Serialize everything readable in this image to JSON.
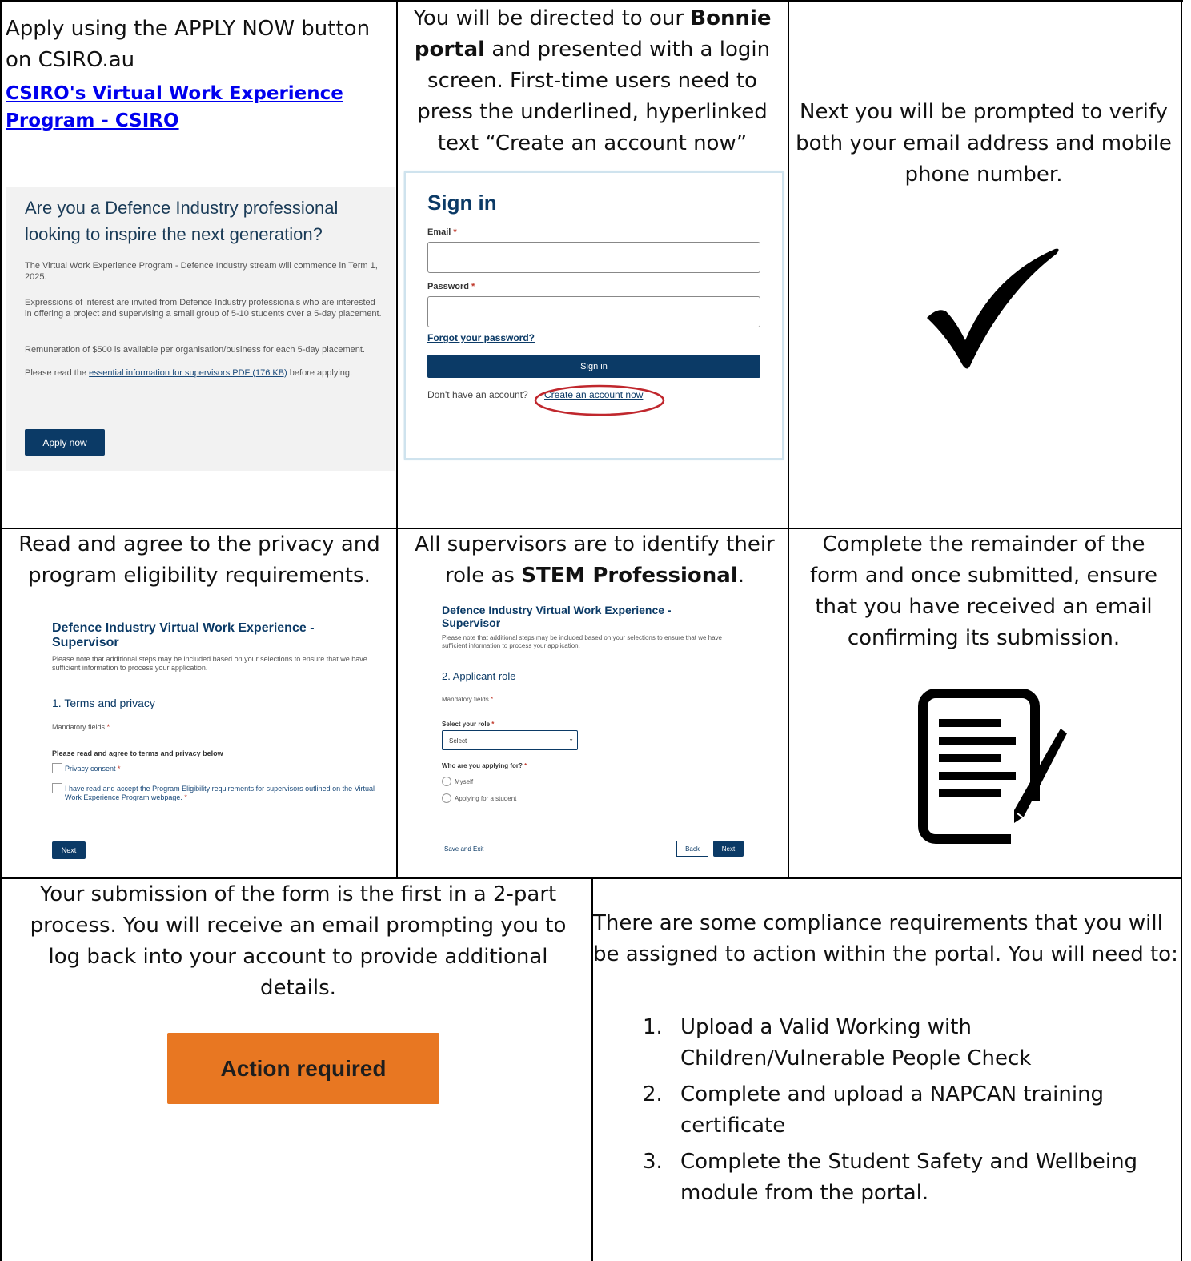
{
  "cell1": {
    "intro": "Apply using the APPLY NOW button on CSIRO.au",
    "link": "CSIRO's Virtual Work Experience Program - CSIRO",
    "screenshot": {
      "heading": "Are you a Defence Industry professional looking to inspire the next generation?",
      "para1": "The Virtual Work Experience Program - Defence Industry stream will commence in Term 1, 2025.",
      "para2": "Expressions of interest are invited from Defence Industry professionals who are interested in offering a project and supervising a small group of 5-10 students over a 5-day placement.",
      "para3": "Remuneration of $500 is available per organisation/business for each 5-day placement.",
      "para4_pre": "Please read the ",
      "para4_link": "essential information for supervisors PDF (176 KB)",
      "para4_post": " before applying.",
      "button": "Apply now"
    }
  },
  "cell2": {
    "text_pre": "You will be directed to our ",
    "text_bold": "Bonnie portal",
    "text_post": " and presented with a login screen. First-time users need to press the underlined, hyperlinked text “Create an account now”",
    "signin": {
      "title": "Sign in",
      "email_label": "Email",
      "password_label": "Password",
      "required_mark": "*",
      "forgot": "Forgot your password?",
      "button": "Sign in",
      "no_account": "Don't have an account?",
      "create": "Create an account now"
    }
  },
  "cell3": {
    "text": "Next you will be prompted to verify both your email address and mobile phone number.",
    "icon": "checkmark-icon"
  },
  "cell4": {
    "text": "Read and agree to the privacy and program eligibility requirements.",
    "form": {
      "title": "Defence Industry Virtual Work Experience - Supervisor",
      "note": "Please note that additional steps may be included based on your selections to ensure that we have sufficient information to process your application.",
      "section": "1. Terms and privacy",
      "mandatory": "Mandatory fields",
      "prompt": "Please read and agree to terms and privacy below",
      "check1": "Privacy consent",
      "check2": "I have read and accept the Program Eligibility requirements for supervisors outlined on the Virtual Work Experience Program webpage.",
      "next": "Next"
    }
  },
  "cell5": {
    "text_pre": "All supervisors are to identify their role as ",
    "text_bold": "STEM Professional",
    "text_post": ".",
    "form": {
      "title": "Defence Industry Virtual Work Experience - Supervisor",
      "note": "Please note that additional steps may be included based on your selections to ensure that we have sufficient information to process your application.",
      "section": "2. Applicant role",
      "mandatory": "Mandatory fields",
      "role_label": "Select your role",
      "select_value": "Select",
      "who_label": "Who are you applying for?",
      "radio1": "Myself",
      "radio2": "Applying for a student",
      "save_exit": "Save and Exit",
      "back": "Back",
      "next": "Next"
    }
  },
  "cell6": {
    "text": "Complete the remainder of the form and once submitted, ensure that you have received an email confirming its submission.",
    "icon": "document-edit-icon"
  },
  "cell7": {
    "text": "Your submission of the form is the first in a 2-part process. You will receive an email prompting you to log back into your account to provide additional details.",
    "badge": "Action required",
    "badge_color": "#e87722"
  },
  "cell8": {
    "intro": "There are some compliance requirements that you will be assigned to action within the portal. You will need to:",
    "items": [
      {
        "num": "1.",
        "text": "Upload a Valid Working with Children/Vulnerable People Check"
      },
      {
        "num": "2.",
        "text": "Complete and upload a NAPCAN training certificate"
      },
      {
        "num": "3.",
        "text": "Complete the Student Safety and Wellbeing module from the portal."
      }
    ]
  }
}
